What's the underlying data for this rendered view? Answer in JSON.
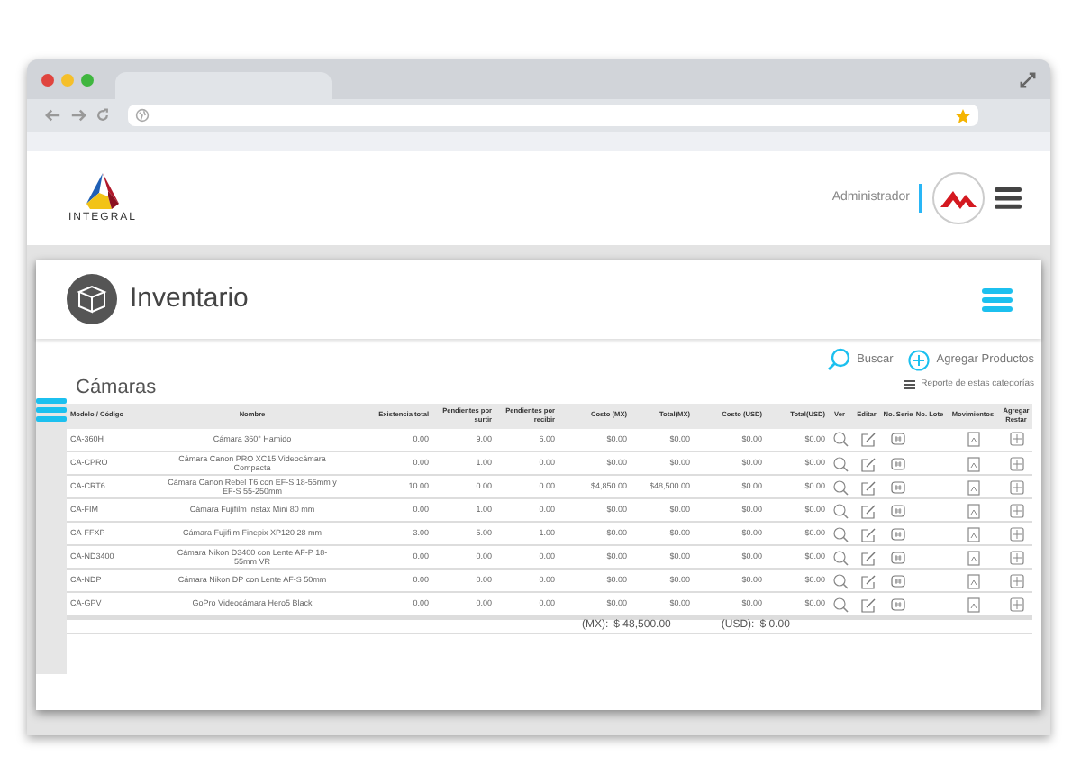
{
  "header": {
    "logo_text": "INTEGRAL",
    "user": "Administrador"
  },
  "page": {
    "title": "Inventario"
  },
  "section": {
    "title": "Cámaras",
    "search": "Buscar",
    "add": "Agregar Productos",
    "report": "Reporte de estas categorías"
  },
  "table": {
    "columns": [
      "Modelo / Código",
      "Nombre",
      "Existencia total",
      "Pendientes por surtir",
      "Pendientes por recibir",
      "Costo (MX)",
      "Total(MX)",
      "Costo (USD)",
      "Total(USD)",
      "Ver",
      "Editar",
      "No. Serie",
      "No. Lote",
      "Movimientos",
      "Agregar Restar"
    ],
    "rows": [
      {
        "cells": [
          "CA-360H",
          "Cámara 360° Hamido",
          "0.00",
          "9.00",
          "6.00",
          "$0.00",
          "$0.00",
          "$0.00",
          "$0.00"
        ]
      },
      {
        "cells": [
          "CA-CPRO",
          "Cámara Canon PRO XC15 Videocámara Compacta",
          "0.00",
          "1.00",
          "0.00",
          "$0.00",
          "$0.00",
          "$0.00",
          "$0.00"
        ]
      },
      {
        "cells": [
          "CA-CRT6",
          "Cámara Canon Rebel T6 con EF-S 18-55mm y EF-S 55-250mm",
          "10.00",
          "0.00",
          "0.00",
          "$4,850.00",
          "$48,500.00",
          "$0.00",
          "$0.00"
        ]
      },
      {
        "cells": [
          "CA-FIM",
          "Cámara Fujifilm Instax Mini 80 mm",
          "0.00",
          "1.00",
          "0.00",
          "$0.00",
          "$0.00",
          "$0.00",
          "$0.00"
        ]
      },
      {
        "cells": [
          "CA-FFXP",
          "Cámara Fujifilm Finepix XP120 28 mm",
          "3.00",
          "5.00",
          "1.00",
          "$0.00",
          "$0.00",
          "$0.00",
          "$0.00"
        ]
      },
      {
        "cells": [
          "CA-ND3400",
          "Cámara Nikon D3400 con Lente AF-P 18-55mm VR",
          "0.00",
          "0.00",
          "0.00",
          "$0.00",
          "$0.00",
          "$0.00",
          "$0.00"
        ]
      },
      {
        "cells": [
          "CA-NDP",
          "Cámara Nikon DP con Lente AF-S 50mm",
          "0.00",
          "0.00",
          "0.00",
          "$0.00",
          "$0.00",
          "$0.00",
          "$0.00"
        ]
      },
      {
        "cells": [
          "CA-GPV",
          "GoPro Videocámara Hero5 Black",
          "0.00",
          "0.00",
          "0.00",
          "$0.00",
          "$0.00",
          "$0.00",
          "$0.00"
        ]
      }
    ]
  },
  "totals": {
    "mx_label": "(MX):",
    "mx_value": "$ 48,500.00",
    "usd_label": "(USD):",
    "usd_value": "$ 0.00"
  }
}
